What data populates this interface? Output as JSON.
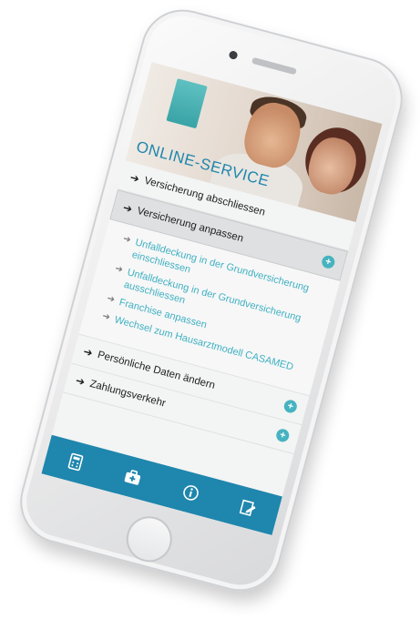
{
  "screen": {
    "title": "ONLINE-SERVICE"
  },
  "menu": [
    {
      "label": "Versicherung abschliessen",
      "expandable": false
    },
    {
      "label": "Versicherung anpassen",
      "expandable": true,
      "active": true
    }
  ],
  "submenu": [
    {
      "label": "Unfalldeckung in der Grundversicherung einschliessen"
    },
    {
      "label": "Unfalldeckung in der Grundversicherung ausschliessen"
    },
    {
      "label": "Franchise anpassen"
    },
    {
      "label": "Wechsel zum Hausarztmodell CASAMED"
    }
  ],
  "menu_bottom": [
    {
      "label": "Persönliche Daten ändern",
      "expandable": true
    },
    {
      "label": "Zahlungsverkehr",
      "expandable": true
    }
  ],
  "tabbar": [
    {
      "icon": "calculator-icon"
    },
    {
      "icon": "medical-case-icon"
    },
    {
      "icon": "info-icon"
    },
    {
      "icon": "edit-document-icon"
    }
  ],
  "colors": {
    "accent": "#1f86ad",
    "link": "#3eb0c2",
    "plus": "#46b3c0"
  }
}
